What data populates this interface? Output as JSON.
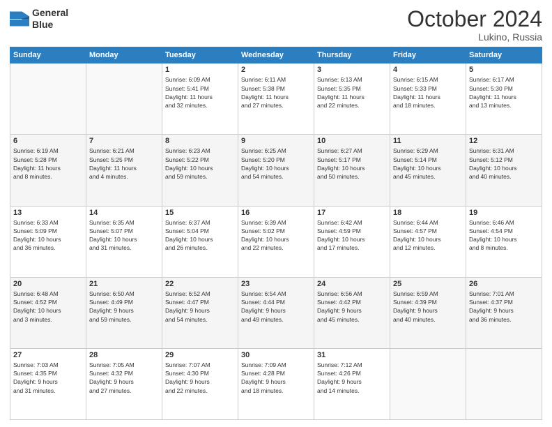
{
  "header": {
    "logo_line1": "General",
    "logo_line2": "Blue",
    "month": "October 2024",
    "location": "Lukino, Russia"
  },
  "weekdays": [
    "Sunday",
    "Monday",
    "Tuesday",
    "Wednesday",
    "Thursday",
    "Friday",
    "Saturday"
  ],
  "weeks": [
    [
      {
        "day": "",
        "info": ""
      },
      {
        "day": "",
        "info": ""
      },
      {
        "day": "1",
        "info": "Sunrise: 6:09 AM\nSunset: 5:41 PM\nDaylight: 11 hours\nand 32 minutes."
      },
      {
        "day": "2",
        "info": "Sunrise: 6:11 AM\nSunset: 5:38 PM\nDaylight: 11 hours\nand 27 minutes."
      },
      {
        "day": "3",
        "info": "Sunrise: 6:13 AM\nSunset: 5:35 PM\nDaylight: 11 hours\nand 22 minutes."
      },
      {
        "day": "4",
        "info": "Sunrise: 6:15 AM\nSunset: 5:33 PM\nDaylight: 11 hours\nand 18 minutes."
      },
      {
        "day": "5",
        "info": "Sunrise: 6:17 AM\nSunset: 5:30 PM\nDaylight: 11 hours\nand 13 minutes."
      }
    ],
    [
      {
        "day": "6",
        "info": "Sunrise: 6:19 AM\nSunset: 5:28 PM\nDaylight: 11 hours\nand 8 minutes."
      },
      {
        "day": "7",
        "info": "Sunrise: 6:21 AM\nSunset: 5:25 PM\nDaylight: 11 hours\nand 4 minutes."
      },
      {
        "day": "8",
        "info": "Sunrise: 6:23 AM\nSunset: 5:22 PM\nDaylight: 10 hours\nand 59 minutes."
      },
      {
        "day": "9",
        "info": "Sunrise: 6:25 AM\nSunset: 5:20 PM\nDaylight: 10 hours\nand 54 minutes."
      },
      {
        "day": "10",
        "info": "Sunrise: 6:27 AM\nSunset: 5:17 PM\nDaylight: 10 hours\nand 50 minutes."
      },
      {
        "day": "11",
        "info": "Sunrise: 6:29 AM\nSunset: 5:14 PM\nDaylight: 10 hours\nand 45 minutes."
      },
      {
        "day": "12",
        "info": "Sunrise: 6:31 AM\nSunset: 5:12 PM\nDaylight: 10 hours\nand 40 minutes."
      }
    ],
    [
      {
        "day": "13",
        "info": "Sunrise: 6:33 AM\nSunset: 5:09 PM\nDaylight: 10 hours\nand 36 minutes."
      },
      {
        "day": "14",
        "info": "Sunrise: 6:35 AM\nSunset: 5:07 PM\nDaylight: 10 hours\nand 31 minutes."
      },
      {
        "day": "15",
        "info": "Sunrise: 6:37 AM\nSunset: 5:04 PM\nDaylight: 10 hours\nand 26 minutes."
      },
      {
        "day": "16",
        "info": "Sunrise: 6:39 AM\nSunset: 5:02 PM\nDaylight: 10 hours\nand 22 minutes."
      },
      {
        "day": "17",
        "info": "Sunrise: 6:42 AM\nSunset: 4:59 PM\nDaylight: 10 hours\nand 17 minutes."
      },
      {
        "day": "18",
        "info": "Sunrise: 6:44 AM\nSunset: 4:57 PM\nDaylight: 10 hours\nand 12 minutes."
      },
      {
        "day": "19",
        "info": "Sunrise: 6:46 AM\nSunset: 4:54 PM\nDaylight: 10 hours\nand 8 minutes."
      }
    ],
    [
      {
        "day": "20",
        "info": "Sunrise: 6:48 AM\nSunset: 4:52 PM\nDaylight: 10 hours\nand 3 minutes."
      },
      {
        "day": "21",
        "info": "Sunrise: 6:50 AM\nSunset: 4:49 PM\nDaylight: 9 hours\nand 59 minutes."
      },
      {
        "day": "22",
        "info": "Sunrise: 6:52 AM\nSunset: 4:47 PM\nDaylight: 9 hours\nand 54 minutes."
      },
      {
        "day": "23",
        "info": "Sunrise: 6:54 AM\nSunset: 4:44 PM\nDaylight: 9 hours\nand 49 minutes."
      },
      {
        "day": "24",
        "info": "Sunrise: 6:56 AM\nSunset: 4:42 PM\nDaylight: 9 hours\nand 45 minutes."
      },
      {
        "day": "25",
        "info": "Sunrise: 6:59 AM\nSunset: 4:39 PM\nDaylight: 9 hours\nand 40 minutes."
      },
      {
        "day": "26",
        "info": "Sunrise: 7:01 AM\nSunset: 4:37 PM\nDaylight: 9 hours\nand 36 minutes."
      }
    ],
    [
      {
        "day": "27",
        "info": "Sunrise: 7:03 AM\nSunset: 4:35 PM\nDaylight: 9 hours\nand 31 minutes."
      },
      {
        "day": "28",
        "info": "Sunrise: 7:05 AM\nSunset: 4:32 PM\nDaylight: 9 hours\nand 27 minutes."
      },
      {
        "day": "29",
        "info": "Sunrise: 7:07 AM\nSunset: 4:30 PM\nDaylight: 9 hours\nand 22 minutes."
      },
      {
        "day": "30",
        "info": "Sunrise: 7:09 AM\nSunset: 4:28 PM\nDaylight: 9 hours\nand 18 minutes."
      },
      {
        "day": "31",
        "info": "Sunrise: 7:12 AM\nSunset: 4:26 PM\nDaylight: 9 hours\nand 14 minutes."
      },
      {
        "day": "",
        "info": ""
      },
      {
        "day": "",
        "info": ""
      }
    ]
  ]
}
